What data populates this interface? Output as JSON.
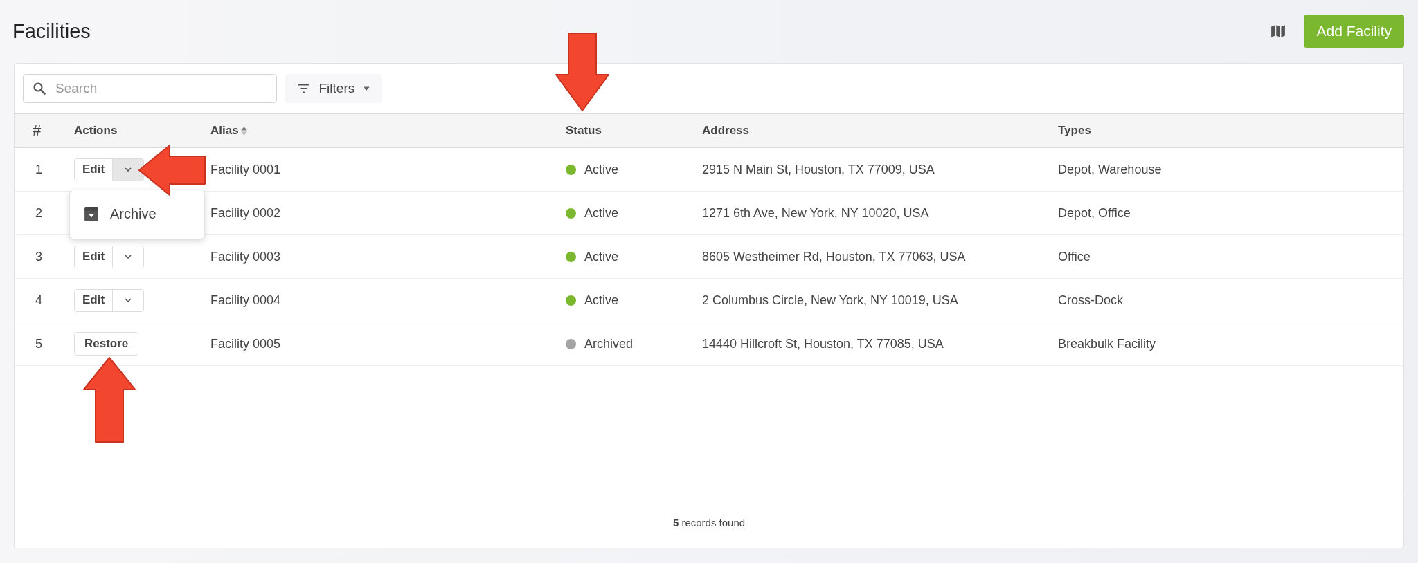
{
  "page": {
    "title": "Facilities",
    "add_button": "Add Facility"
  },
  "toolbar": {
    "search": {
      "placeholder": "Search"
    },
    "filters": "Filters"
  },
  "table": {
    "columns": [
      {
        "label": "#",
        "sortable": false
      },
      {
        "label": "Actions",
        "sortable": false
      },
      {
        "label": "Alias",
        "sortable": true
      },
      {
        "label": "Status",
        "sortable": false
      },
      {
        "label": "Address",
        "sortable": false
      },
      {
        "label": "Types",
        "sortable": false
      }
    ],
    "rows": [
      {
        "number": "1",
        "action": {
          "kind": "split",
          "label": "Edit",
          "expanded": true,
          "menu": [
            {
              "label": "Archive"
            }
          ]
        },
        "alias": "Facility 0001",
        "status": {
          "label": "Active",
          "color": "#7cb82f"
        },
        "address": "2915 N Main St, Houston, TX 77009, USA",
        "types": "Depot, Warehouse"
      },
      {
        "number": "2",
        "action": {
          "kind": "covered"
        },
        "alias": "Facility 0002",
        "status": {
          "label": "Active",
          "color": "#7cb82f"
        },
        "address": "1271 6th Ave, New York, NY 10020, USA",
        "types": "Depot, Office"
      },
      {
        "number": "3",
        "action": {
          "kind": "split",
          "label": "Edit",
          "expanded": false
        },
        "alias": "Facility 0003",
        "status": {
          "label": "Active",
          "color": "#7cb82f"
        },
        "address": "8605 Westheimer Rd, Houston, TX 77063, USA",
        "types": "Office"
      },
      {
        "number": "4",
        "action": {
          "kind": "split",
          "label": "Edit",
          "expanded": false
        },
        "alias": "Facility 0004",
        "status": {
          "label": "Active",
          "color": "#7cb82f"
        },
        "address": "2 Columbus Circle, New York, NY 10019, USA",
        "types": "Cross-Dock"
      },
      {
        "number": "5",
        "action": {
          "kind": "single",
          "label": "Restore"
        },
        "alias": "Facility 0005",
        "status": {
          "label": "Archived",
          "color": "#a3a3a3"
        },
        "address": "14440 Hillcroft St, Houston, TX 77085, USA",
        "types": "Breakbulk Facility"
      }
    ]
  },
  "footer": "**5** records found",
  "annotation_arrows": [
    {
      "kind": "down"
    },
    {
      "kind": "left"
    },
    {
      "kind": "up"
    }
  ]
}
